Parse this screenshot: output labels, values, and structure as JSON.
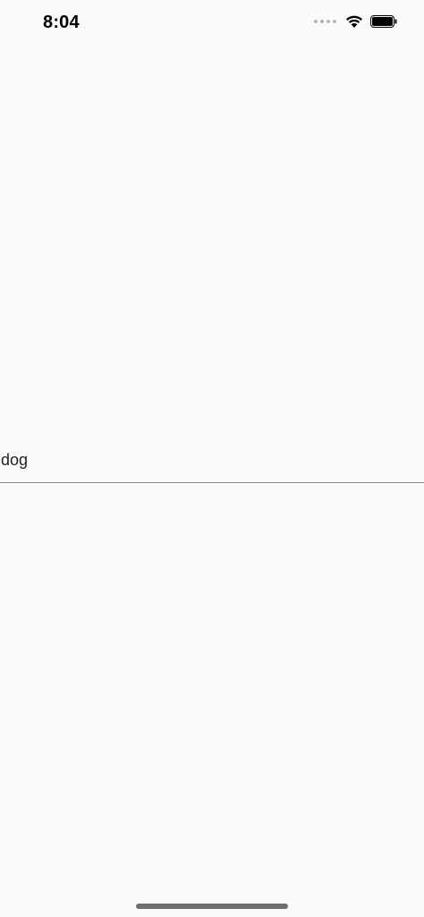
{
  "status_bar": {
    "time": "8:04",
    "icons": [
      "cellular-dots-icon",
      "wifi-icon",
      "battery-icon"
    ]
  },
  "search": {
    "value": "dog"
  },
  "colors": {
    "background": "#fafafa",
    "text": "#222222",
    "divider": "#8a8a8a"
  }
}
